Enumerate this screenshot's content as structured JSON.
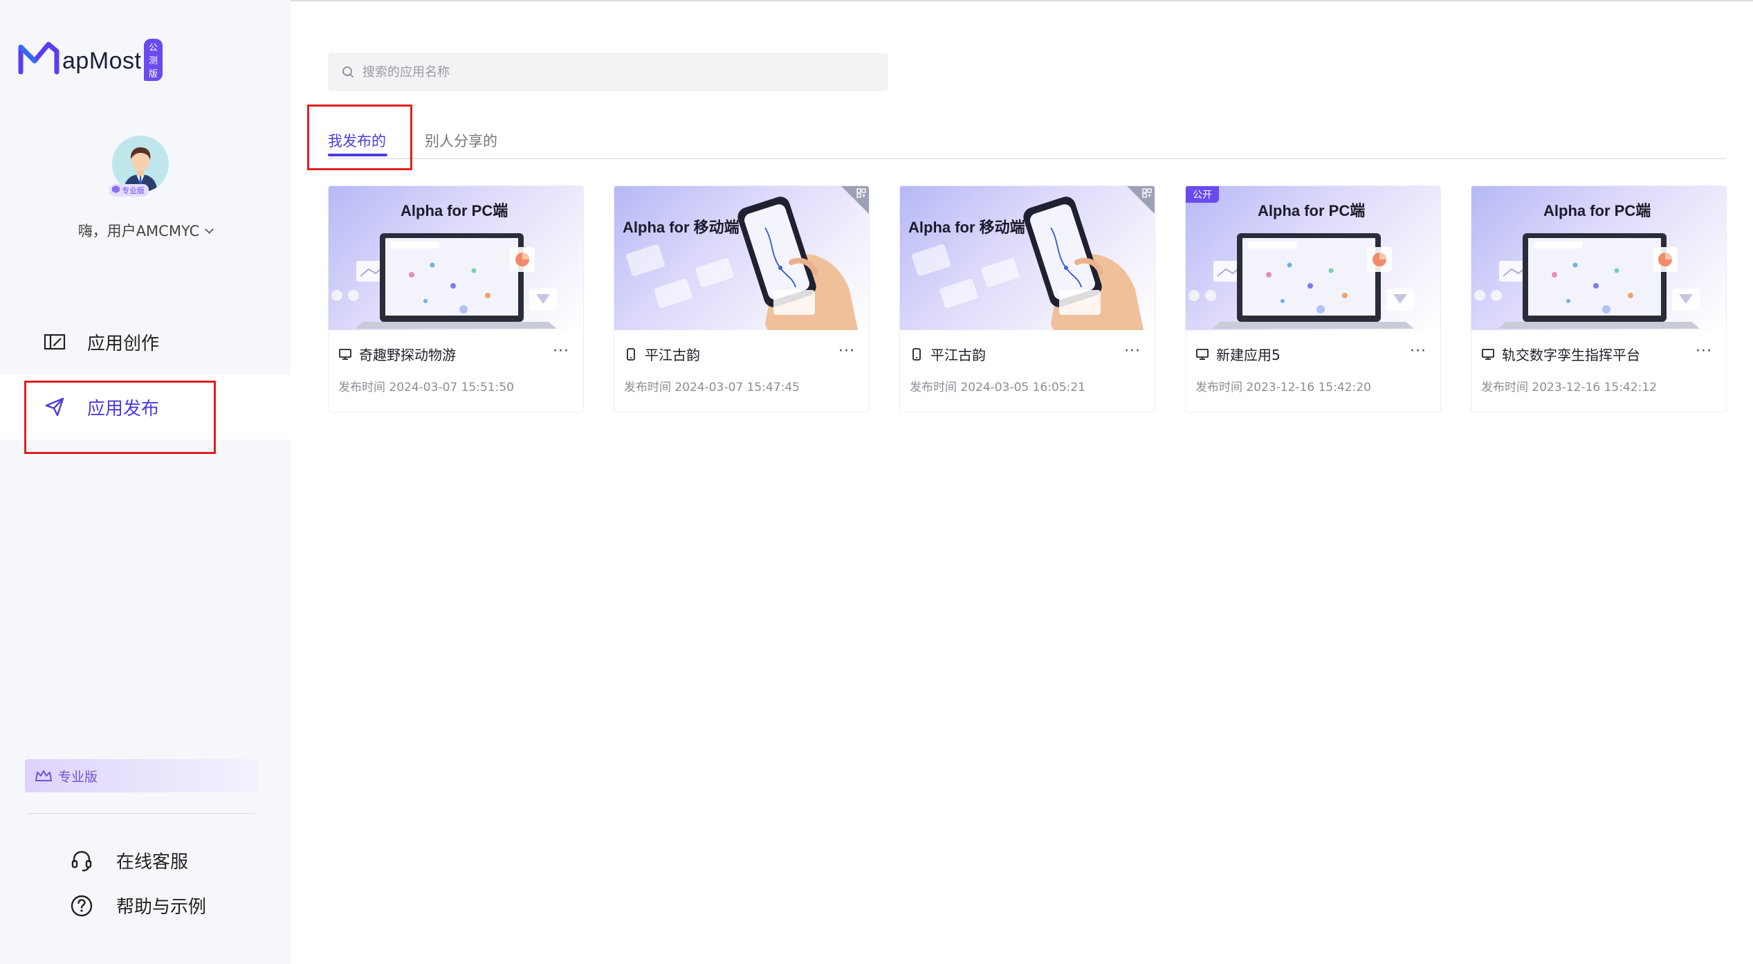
{
  "brand": {
    "logo_text": "apMost",
    "badge": "公测版"
  },
  "user": {
    "greeting": "嗨，用户AMCMYC",
    "level_badge": "专业版"
  },
  "nav": [
    {
      "label": "应用创作",
      "icon": "edit-panel-icon",
      "active": false
    },
    {
      "label": "应用发布",
      "icon": "send-icon",
      "active": true
    }
  ],
  "pro_banner": {
    "label": "专业版"
  },
  "footer": [
    {
      "label": "在线客服",
      "icon": "headset-icon"
    },
    {
      "label": "帮助与示例",
      "icon": "help-circle-icon"
    }
  ],
  "search": {
    "placeholder": "搜索的应用名称"
  },
  "tabs": [
    {
      "label": "我发布的",
      "active": true
    },
    {
      "label": "别人分享的",
      "active": false
    }
  ],
  "cards": [
    {
      "thumb_title": "Alpha for PC端",
      "variant": "pc",
      "tag": "",
      "qr": false,
      "name": "奇趣野探动物游",
      "device": "monitor-icon",
      "time": "发布时间 2024-03-07 15:51:50"
    },
    {
      "thumb_title": "Alpha for 移动端",
      "variant": "mobile",
      "tag": "",
      "qr": true,
      "name": "平江古韵",
      "device": "mobile-icon",
      "time": "发布时间 2024-03-07 15:47:45"
    },
    {
      "thumb_title": "Alpha for 移动端",
      "variant": "mobile",
      "tag": "",
      "qr": true,
      "name": "平江古韵",
      "device": "mobile-icon",
      "time": "发布时间 2024-03-05 16:05:21"
    },
    {
      "thumb_title": "Alpha for PC端",
      "variant": "pc",
      "tag": "公开",
      "qr": false,
      "name": "新建应用5",
      "device": "monitor-icon",
      "time": "发布时间 2023-12-16 15:42:20"
    },
    {
      "thumb_title": "Alpha for PC端",
      "variant": "pc",
      "tag": "",
      "qr": false,
      "name": "轨交数字孪生指挥平台",
      "device": "monitor-icon",
      "time": "发布时间 2023-12-16 15:42:12"
    }
  ],
  "more_label": "···",
  "colors": {
    "accent": "#4a3be0",
    "brand": "#6a4bf0",
    "highlight": "#e02020",
    "sidebar_bg": "#f6f7fb"
  }
}
